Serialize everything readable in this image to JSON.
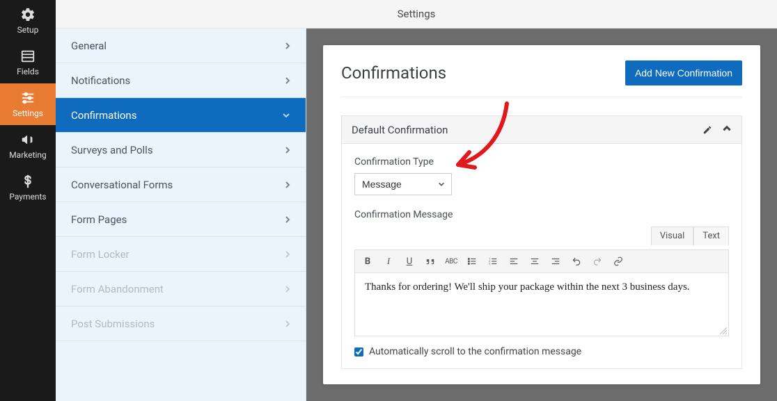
{
  "header": {
    "title": "Settings"
  },
  "iconbar": {
    "items": [
      {
        "label": "Setup",
        "icon": "gear-icon"
      },
      {
        "label": "Fields",
        "icon": "fields-icon"
      },
      {
        "label": "Settings",
        "icon": "sliders-icon",
        "active": true
      },
      {
        "label": "Marketing",
        "icon": "megaphone-icon"
      },
      {
        "label": "Payments",
        "icon": "dollar-icon"
      }
    ]
  },
  "submenu": {
    "items": [
      {
        "label": "General"
      },
      {
        "label": "Notifications"
      },
      {
        "label": "Confirmations",
        "active": true
      },
      {
        "label": "Surveys and Polls"
      },
      {
        "label": "Conversational Forms"
      },
      {
        "label": "Form Pages"
      },
      {
        "label": "Form Locker",
        "disabled": true
      },
      {
        "label": "Form Abandonment",
        "disabled": true
      },
      {
        "label": "Post Submissions",
        "disabled": true
      }
    ]
  },
  "panel": {
    "title": "Confirmations",
    "add_button": "Add New Confirmation",
    "accordion_title": "Default Confirmation",
    "type_label": "Confirmation Type",
    "type_value": "Message",
    "message_label": "Confirmation Message",
    "tabs": {
      "visual": "Visual",
      "text": "Text"
    },
    "message_value": "Thanks for ordering! We'll ship your package within the next 3 business days.",
    "autoscroll_label": "Automatically scroll to the confirmation message",
    "autoscroll_checked": true
  }
}
